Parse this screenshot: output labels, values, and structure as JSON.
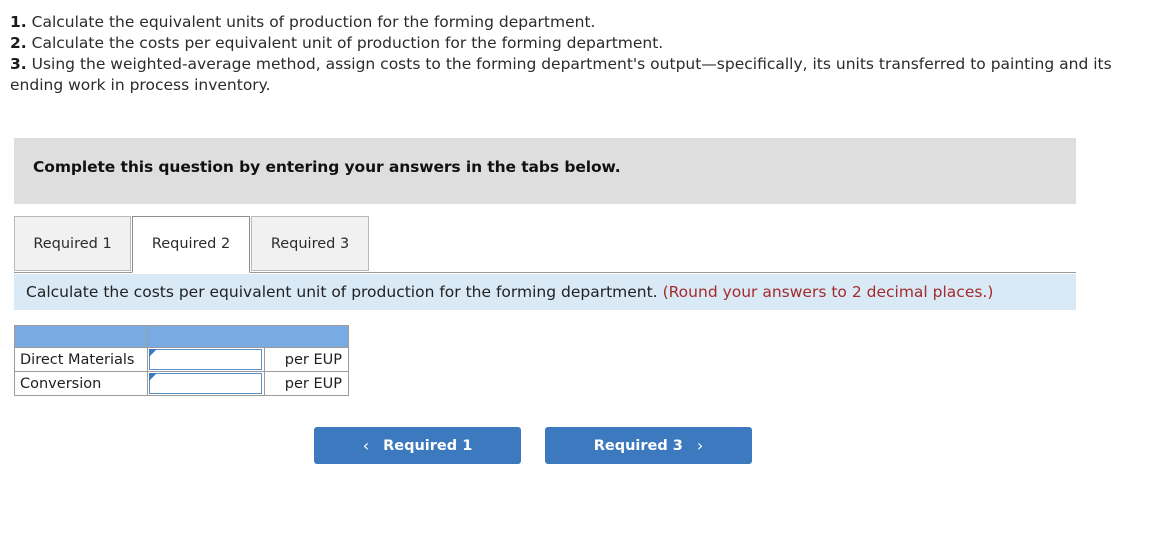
{
  "questions": [
    {
      "num": "1.",
      "text": "Calculate the equivalent units of production for the forming department."
    },
    {
      "num": "2.",
      "text": "Calculate the costs per equivalent unit of production for the forming department."
    },
    {
      "num": "3.",
      "text": "Using the weighted-average method, assign costs to the forming department's output—specifically, its units transferred to painting and its ending work in process inventory."
    }
  ],
  "banner": {
    "text": "Complete this question by entering your answers in the tabs below."
  },
  "tabs": [
    {
      "label": "Required 1",
      "active": false
    },
    {
      "label": "Required 2",
      "active": true
    },
    {
      "label": "Required 3",
      "active": false
    }
  ],
  "instruction": {
    "main": "Calculate the costs per equivalent unit of production for the forming department.",
    "note": "(Round your answers to 2 decimal places.)"
  },
  "table": {
    "header": {
      "col1": "",
      "col2": ""
    },
    "rows": [
      {
        "label": "Direct Materials",
        "value": "",
        "unit": "per EUP"
      },
      {
        "label": "Conversion",
        "value": "",
        "unit": "per EUP"
      }
    ]
  },
  "nav": {
    "prev_label": "Required 1",
    "next_label": "Required 3",
    "prev_icon": "chevron-left-icon",
    "next_icon": "chevron-right-icon",
    "prev_glyph": "‹",
    "next_glyph": "›"
  },
  "colors": {
    "button_blue": "#3d79bf",
    "table_header_blue": "#77abe2",
    "instruction_bar_blue": "#d9e9f6",
    "banner_gray": "#dedede",
    "note_red": "#a32b2b"
  }
}
